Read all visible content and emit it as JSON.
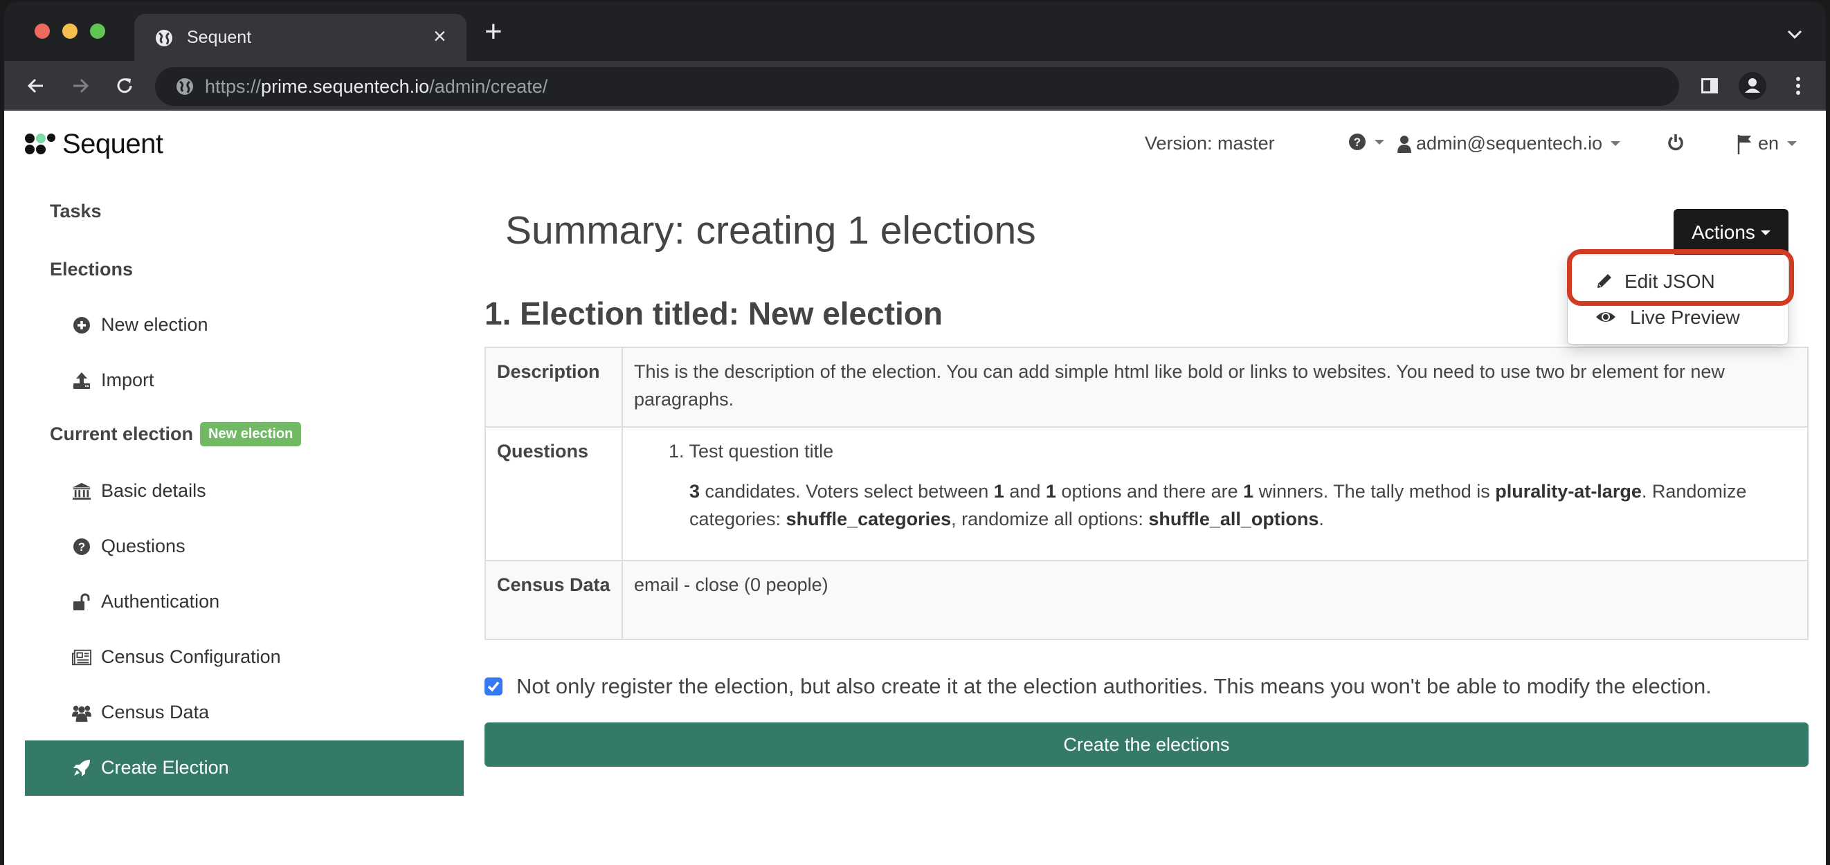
{
  "browser": {
    "tab_title": "Sequent",
    "tab_close": "×",
    "new_tab": "+",
    "url_scheme": "https://",
    "url_host": "prime.sequentech.io",
    "url_path": "/admin/create/"
  },
  "header": {
    "logo_text": "Sequent",
    "version": "Version: master",
    "user_email": "admin@sequentech.io",
    "language": "en"
  },
  "sidebar": {
    "tasks": "Tasks",
    "elections": "Elections",
    "current_election": "Current election",
    "current_election_badge": "New election",
    "items": [
      {
        "label": "New election",
        "icon": "plus-circle-icon"
      },
      {
        "label": "Import",
        "icon": "upload-icon"
      },
      {
        "label": "Basic details",
        "icon": "institution-icon"
      },
      {
        "label": "Questions",
        "icon": "question-circle-icon"
      },
      {
        "label": "Authentication",
        "icon": "unlock-icon"
      },
      {
        "label": "Census Configuration",
        "icon": "newspaper-icon"
      },
      {
        "label": "Census Data",
        "icon": "users-icon"
      },
      {
        "label": "Create Election",
        "icon": "rocket-icon",
        "active": true
      }
    ]
  },
  "main": {
    "title": "Summary: creating 1 elections",
    "actions_label": "Actions",
    "actions_menu": [
      {
        "label": "Edit JSON",
        "icon": "pencil-icon",
        "highlighted": true
      },
      {
        "label": "Live Preview",
        "icon": "eye-icon"
      }
    ],
    "election_heading": "1. Election titled: New election",
    "table": {
      "description_key": "Description",
      "description_value": "This is the description of the election. You can add simple html like bold or links to websites. You need to use two br element for new paragraphs.",
      "questions_key": "Questions",
      "question_title": "1. Test question title",
      "question_detail": {
        "candidates": "3",
        "t1": " candidates. Voters select between ",
        "min": "1",
        "t2": " and ",
        "max": "1",
        "t3": " options and there are ",
        "winners": "1",
        "t4": " winners. The tally method is ",
        "tally_method": "plurality-at-large",
        "t5": ". Randomize categories: ",
        "shuffle_categories": "shuffle_categories",
        "t6": ", randomize all options: ",
        "shuffle_all_options": "shuffle_all_options",
        "t7": "."
      },
      "census_key": "Census Data",
      "census_value": "email - close (0 people)"
    },
    "create_checkbox_checked": true,
    "create_checkbox_label": "Not only register the election, but also create it at the election authorities. This means you won't be able to modify the election.",
    "create_button": "Create the elections"
  },
  "colors": {
    "accent_green": "#357a69",
    "badge_green": "#72b966",
    "highlight_red": "#d13b22",
    "checkbox_blue": "#3478f6"
  }
}
